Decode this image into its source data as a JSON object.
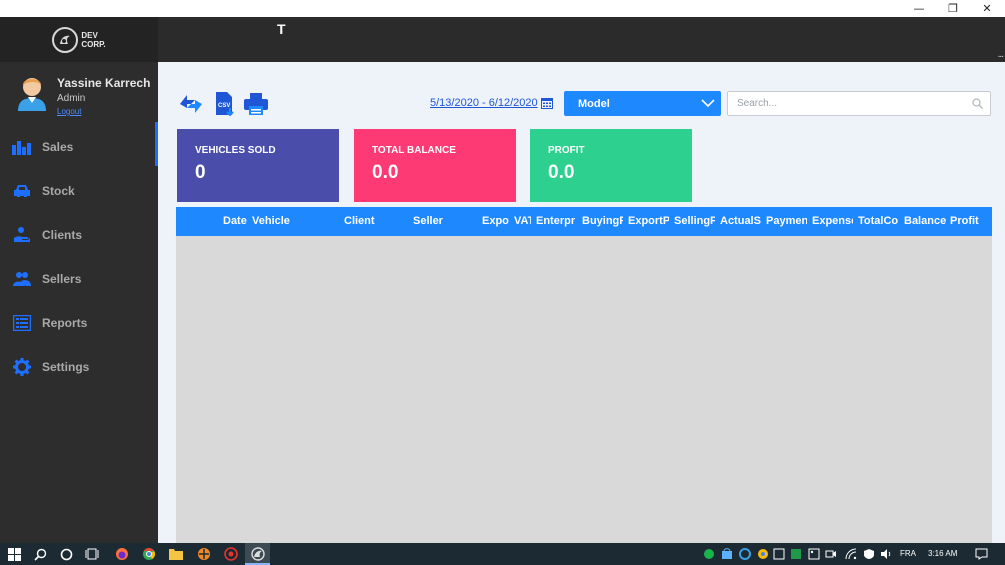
{
  "window": {
    "minimize_glyph": "—",
    "restore_glyph": "❐",
    "close_glyph": "✕"
  },
  "brand": {
    "line1": "DEV",
    "line2": "CORP."
  },
  "user": {
    "name": "Yassine Karrech",
    "role": "Admin",
    "logout": "Logout"
  },
  "nav": [
    {
      "label": "Sales",
      "icon": "bar-chart-icon",
      "active": true
    },
    {
      "label": "Stock",
      "icon": "car-icon",
      "active": false
    },
    {
      "label": "Clients",
      "icon": "hand-user-icon",
      "active": false
    },
    {
      "label": "Sellers",
      "icon": "users-icon",
      "active": false
    },
    {
      "label": "Reports",
      "icon": "list-report-icon",
      "active": false
    },
    {
      "label": "Settings",
      "icon": "gear-icon",
      "active": false
    }
  ],
  "header": {
    "title": "T",
    "dots": "..."
  },
  "toolbar": {
    "refresh_icon": "refresh-icon",
    "csv_icon": "csv-export-icon",
    "print_icon": "print-icon",
    "date_range": "5/13/2020 - 6/12/2020",
    "model_label": "Model",
    "search_placeholder": "Search..."
  },
  "cards": [
    {
      "title": "VEHICLES SOLD",
      "value": "0",
      "color": "#4a4eaa"
    },
    {
      "title": "TOTAL BALANCE",
      "value": "0.0",
      "color": "#fd3a73"
    },
    {
      "title": "PROFIT",
      "value": "0.0",
      "color": "#2ed08f"
    }
  ],
  "table": {
    "columns": [
      "Date",
      "Vehicle",
      "Client",
      "Seller",
      "Expo",
      "VAT",
      "Enterpr",
      "BuyingP",
      "ExportP",
      "SellingP",
      "ActualS",
      "Paymen",
      "Expense",
      "TotalCo",
      "Balance",
      "Profit"
    ],
    "rows": []
  },
  "taskbar": {
    "language": "FRA",
    "time": "3:16 AM"
  },
  "colors": {
    "accent": "#1e88ff",
    "sidebar": "#2d2d2d",
    "header": "#2b2b2b",
    "main_bg": "#eef3fa",
    "table_body": "#d9d9d9"
  }
}
